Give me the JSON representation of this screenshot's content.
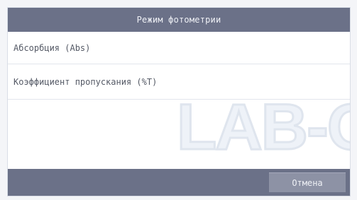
{
  "dialog": {
    "title": "Режим фотометрии",
    "options": [
      {
        "label": "Абсорбция (Abs)"
      },
      {
        "label": "Коэффициент пропускания (%T)"
      }
    ],
    "cancel_label": "Отмена"
  },
  "watermark": {
    "text": "LAB-O"
  },
  "colors": {
    "header_bg": "#6b7188",
    "footer_bg": "#6b7188",
    "button_bg": "#8d92a5",
    "text": "#555a66"
  }
}
